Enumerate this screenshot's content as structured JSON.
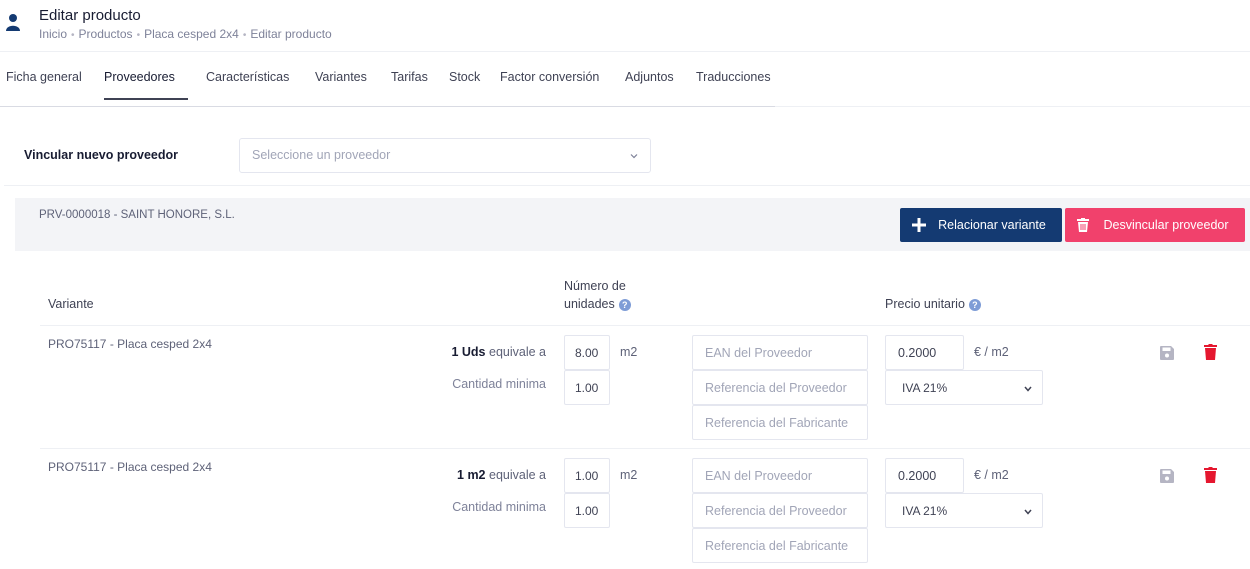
{
  "header": {
    "title": "Editar producto",
    "breadcrumb": [
      "Inicio",
      "Productos",
      "Placa cesped 2x4",
      "Editar producto"
    ]
  },
  "tabs": [
    {
      "label": "Ficha general",
      "active": false
    },
    {
      "label": "Proveedores",
      "active": true
    },
    {
      "label": "Características",
      "active": false
    },
    {
      "label": "Variantes",
      "active": false
    },
    {
      "label": "Tarifas",
      "active": false
    },
    {
      "label": "Stock",
      "active": false
    },
    {
      "label": "Factor conversión",
      "active": false
    },
    {
      "label": "Adjuntos",
      "active": false
    },
    {
      "label": "Traducciones",
      "active": false
    }
  ],
  "link_provider": {
    "label": "Vincular nuevo proveedor",
    "placeholder": "Seleccione un proveedor"
  },
  "provider": {
    "name": "PRV-0000018 - SAINT HONORE, S.L.",
    "relate_button": "Relacionar variante",
    "unlink_button": "Desvincular proveedor"
  },
  "columns": {
    "variant": "Variante",
    "units_line1": "Número de",
    "units_line2": "unidades",
    "unit_price": "Precio unitario"
  },
  "rows": [
    {
      "variant": "PRO75117 - Placa cesped 2x4",
      "equiv_qty": "1 Uds",
      "equiv_text": "equivale a",
      "units_value": "8.00",
      "unit": "m2",
      "min_label": "Cantidad minima",
      "min_value": "1.00",
      "ean_placeholder": "EAN del Proveedor",
      "ref_placeholder": "Referencia del Proveedor",
      "manuf_placeholder": "Referencia del Fabricante",
      "price": "0.2000",
      "price_unit": "€ / m2",
      "tax": "IVA 21%"
    },
    {
      "variant": "PRO75117 - Placa cesped 2x4",
      "equiv_qty": "1 m2",
      "equiv_text": "equivale a",
      "units_value": "1.00",
      "unit": "m2",
      "min_label": "Cantidad minima",
      "min_value": "1.00",
      "ean_placeholder": "EAN del Proveedor",
      "ref_placeholder": "Referencia del Proveedor",
      "manuf_placeholder": "Referencia del Fabricante",
      "price": "0.2000",
      "price_unit": "€ / m2",
      "tax": "IVA 21%"
    }
  ],
  "colors": {
    "primary": "#143a72",
    "danger": "#f1416c",
    "trash_icon": "#e5172f",
    "help_icon": "#7e9cd6"
  },
  "icons": [
    "user-icon",
    "chevron-down-icon",
    "plus-icon",
    "trash-icon",
    "help-icon",
    "save-icon"
  ]
}
